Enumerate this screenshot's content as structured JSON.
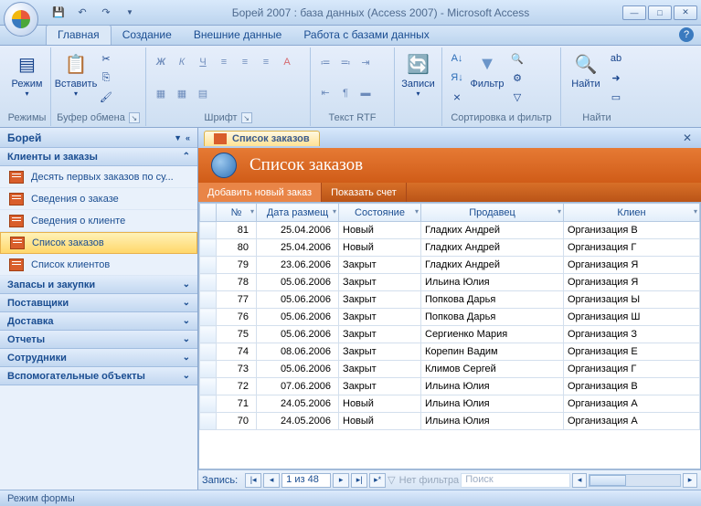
{
  "title": "Борей 2007 : база данных (Access 2007) - Microsoft Access",
  "tabs": [
    "Главная",
    "Создание",
    "Внешние данные",
    "Работа с базами данных"
  ],
  "activeTab": 0,
  "ribbonGroups": {
    "views": {
      "label": "Режим",
      "caption": "Режимы"
    },
    "clipboard": {
      "label": "Вставить",
      "caption": "Буфер обмена"
    },
    "font": {
      "caption": "Шрифт"
    },
    "richtext": {
      "caption": "Текст RTF"
    },
    "records": {
      "label": "Записи"
    },
    "sortfilter": {
      "label": "Фильтр",
      "caption": "Сортировка и фильтр"
    },
    "find": {
      "label": "Найти",
      "caption": "Найти"
    }
  },
  "nav": {
    "title": "Борей",
    "sections": [
      {
        "label": "Клиенты и заказы",
        "open": true,
        "items": [
          "Десять первых заказов по су...",
          "Сведения о заказе",
          "Сведения о клиенте",
          "Список заказов",
          "Список клиентов"
        ],
        "activeIndex": 3
      },
      {
        "label": "Запасы и закупки",
        "open": false
      },
      {
        "label": "Поставщики",
        "open": false
      },
      {
        "label": "Доставка",
        "open": false
      },
      {
        "label": "Отчеты",
        "open": false
      },
      {
        "label": "Сотрудники",
        "open": false
      },
      {
        "label": "Вспомогательные объекты",
        "open": false
      }
    ]
  },
  "docTab": "Список заказов",
  "formTitle": "Список заказов",
  "formToolbar": [
    "Добавить новый заказ",
    "Показать счет"
  ],
  "columns": [
    "№",
    "Дата размещ",
    "Состояние",
    "Продавец",
    "Клиен"
  ],
  "rows": [
    {
      "n": 81,
      "date": "25.04.2006",
      "state": "Новый",
      "seller": "Гладких Андрей",
      "client": "Организация В"
    },
    {
      "n": 80,
      "date": "25.04.2006",
      "state": "Новый",
      "seller": "Гладких Андрей",
      "client": "Организация Г"
    },
    {
      "n": 79,
      "date": "23.06.2006",
      "state": "Закрыт",
      "seller": "Гладких Андрей",
      "client": "Организация Я"
    },
    {
      "n": 78,
      "date": "05.06.2006",
      "state": "Закрыт",
      "seller": "Ильина Юлия",
      "client": "Организация Я"
    },
    {
      "n": 77,
      "date": "05.06.2006",
      "state": "Закрыт",
      "seller": "Попкова Дарья",
      "client": "Организация Ы"
    },
    {
      "n": 76,
      "date": "05.06.2006",
      "state": "Закрыт",
      "seller": "Попкова Дарья",
      "client": "Организация Ш"
    },
    {
      "n": 75,
      "date": "05.06.2006",
      "state": "Закрыт",
      "seller": "Сергиенко Мария",
      "client": "Организация З"
    },
    {
      "n": 74,
      "date": "08.06.2006",
      "state": "Закрыт",
      "seller": "Корепин Вадим",
      "client": "Организация Е"
    },
    {
      "n": 73,
      "date": "05.06.2006",
      "state": "Закрыт",
      "seller": "Климов Сергей",
      "client": "Организация Г"
    },
    {
      "n": 72,
      "date": "07.06.2006",
      "state": "Закрыт",
      "seller": "Ильина Юлия",
      "client": "Организация В"
    },
    {
      "n": 71,
      "date": "24.05.2006",
      "state": "Новый",
      "seller": "Ильина Юлия",
      "client": "Организация А"
    },
    {
      "n": 70,
      "date": "24.05.2006",
      "state": "Новый",
      "seller": "Ильина Юлия",
      "client": "Организация А"
    }
  ],
  "recnav": {
    "label": "Запись:",
    "pos": "1 из 48",
    "nofilter": "Нет фильтра",
    "search": "Поиск"
  },
  "status": "Режим формы"
}
